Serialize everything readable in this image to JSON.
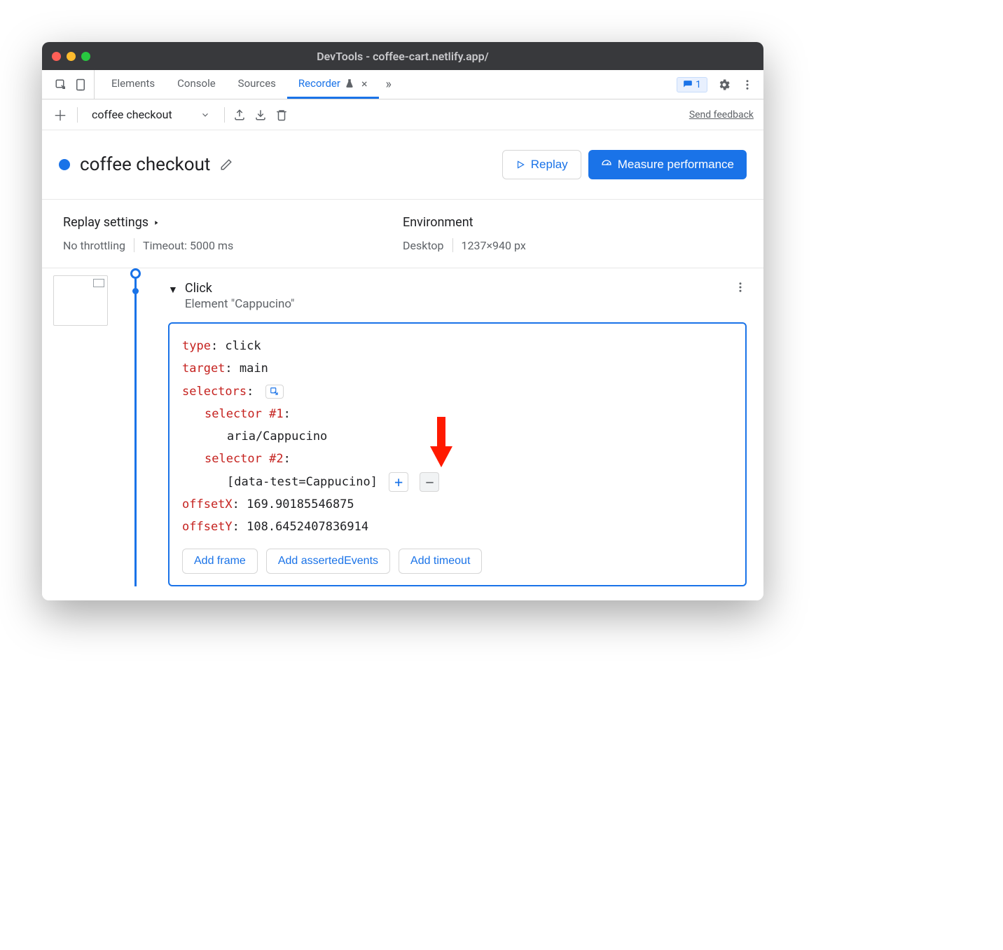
{
  "window": {
    "title": "DevTools - coffee-cart.netlify.app/"
  },
  "tabs": {
    "elements": "Elements",
    "console": "Console",
    "sources": "Sources",
    "recorder": "Recorder",
    "close_glyph": "×",
    "overflow_glyph": "»",
    "badge_count": "1"
  },
  "toolbar": {
    "recording_name": "coffee checkout",
    "send_feedback": "Send feedback"
  },
  "header": {
    "title": "coffee checkout",
    "replay_label": "Replay",
    "measure_label": "Measure performance"
  },
  "settings": {
    "replay_title": "Replay settings",
    "throttling": "No throttling",
    "timeout": "Timeout: 5000 ms",
    "env_title": "Environment",
    "device": "Desktop",
    "dims": "1237×940 px"
  },
  "step": {
    "title": "Click",
    "subtitle": "Element \"Cappucino\"",
    "type_key": "type",
    "type_val": ": click",
    "target_key": "target",
    "target_val": ": main",
    "selectors_key": "selectors",
    "colon": ":",
    "sel1_key": "selector #1",
    "sel1_val": "aria/Cappucino",
    "sel2_key": "selector #2",
    "sel2_val": "[data-test=Cappucino]",
    "offx_key": "offsetX",
    "offx_val": ": 169.90185546875",
    "offy_key": "offsetY",
    "offy_val": ": 108.6452407836914",
    "add_frame": "Add frame",
    "add_asserted": "Add assertedEvents",
    "add_timeout": "Add timeout"
  }
}
